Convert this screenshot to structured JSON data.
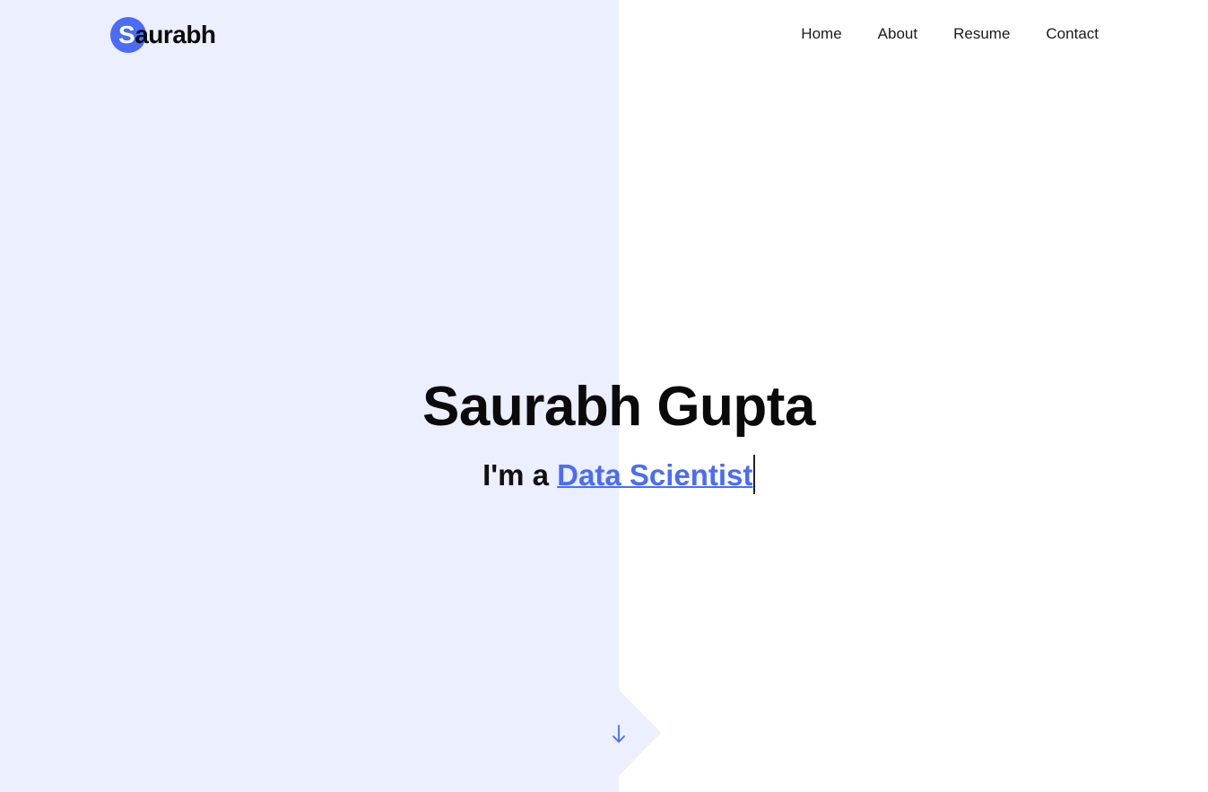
{
  "header": {
    "logo": {
      "initial": "S",
      "rest": "aurabh"
    },
    "nav": [
      {
        "label": "Home"
      },
      {
        "label": "About"
      },
      {
        "label": "Resume"
      },
      {
        "label": "Contact"
      }
    ]
  },
  "hero": {
    "name": "Saurabh Gupta",
    "intro": "I'm a ",
    "role": "Data Scientist"
  },
  "scroll": {
    "icon": "arrow-down-icon"
  },
  "colors": {
    "accent": "#4a6cf7",
    "panel": "#ebeffe",
    "background": "#ffffff",
    "text": "#111111"
  }
}
